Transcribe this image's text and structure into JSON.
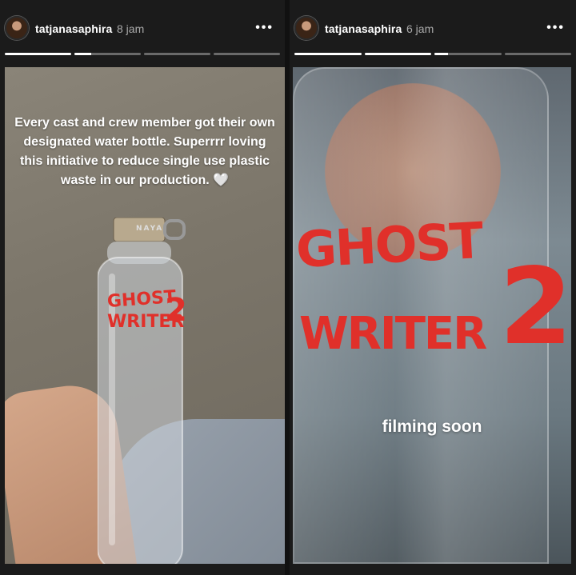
{
  "stories": [
    {
      "username": "tatjanasaphira",
      "time": "8 jam",
      "progress": [
        1.0,
        0.25,
        0.0,
        0.0
      ],
      "caption": "Every cast and crew member got their own designated water bottle. Superrrr loving this initiative to reduce single use plastic waste in our production. 🤍",
      "bottle_cap_text": "NAYA",
      "bottle_print_line1": "GHOST",
      "bottle_print_line2": "WRITER",
      "bottle_print_number": "2"
    },
    {
      "username": "tatjanasaphira",
      "time": "6 jam",
      "progress": [
        1.0,
        1.0,
        0.2,
        0.0
      ],
      "overlay_text": "filming soon",
      "bottle_print_line1": "GHOST",
      "bottle_print_line2": "WRITER",
      "bottle_print_number": "2"
    }
  ],
  "icons": {
    "more": "more-horizontal-icon",
    "avatar": "profile-avatar"
  },
  "colors": {
    "background": "#1b1b1b",
    "print_red": "#e0302a",
    "text": "#ffffff",
    "muted": "#aaaaaa"
  }
}
